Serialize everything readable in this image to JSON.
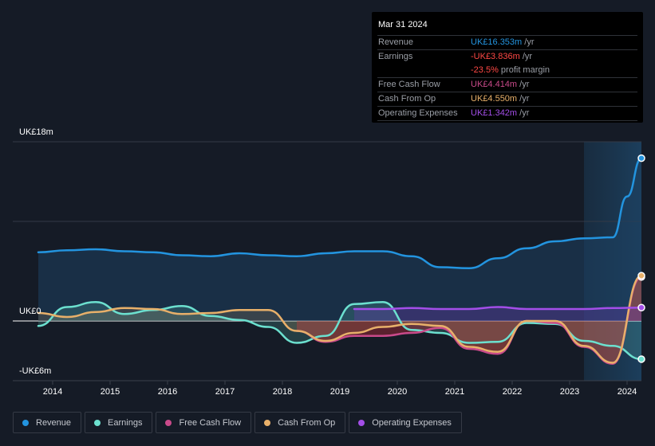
{
  "tooltip": {
    "date": "Mar 31 2024",
    "rows": [
      {
        "label": "Revenue",
        "value": "UK£16.353m",
        "unit": " /yr",
        "color": "#2394df"
      },
      {
        "label": "Earnings",
        "value": "-UK£3.836m",
        "unit": " /yr",
        "color": "#ff4845"
      },
      {
        "label": "",
        "value": "-23.5%",
        "unit": " profit margin",
        "color": "#ff4845"
      },
      {
        "label": "Free Cash Flow",
        "value": "UK£4.414m",
        "unit": " /yr",
        "color": "#c94a8a"
      },
      {
        "label": "Cash From Op",
        "value": "UK£4.550m",
        "unit": " /yr",
        "color": "#e8b06a"
      },
      {
        "label": "Operating Expenses",
        "value": "UK£1.342m",
        "unit": " /yr",
        "color": "#a34ee8"
      }
    ]
  },
  "legend": [
    {
      "label": "Revenue",
      "color": "#2394df"
    },
    {
      "label": "Earnings",
      "color": "#6ce0cf"
    },
    {
      "label": "Free Cash Flow",
      "color": "#c94a8a"
    },
    {
      "label": "Cash From Op",
      "color": "#e8b06a"
    },
    {
      "label": "Operating Expenses",
      "color": "#a34ee8"
    }
  ],
  "chart_data": {
    "type": "line",
    "title": "",
    "xlabel": "",
    "ylabel": "",
    "ylim": [
      -6,
      18
    ],
    "xlim": [
      2013.75,
      2024.25
    ],
    "y_tick_labels": [
      {
        "value": 18,
        "label": "UK£18m"
      },
      {
        "value": 0,
        "label": "UK£0"
      },
      {
        "value": -6,
        "label": "-UK£6m"
      }
    ],
    "gridlines": [
      18,
      10,
      0
    ],
    "x_ticks": [
      2014,
      2015,
      2016,
      2017,
      2018,
      2019,
      2020,
      2021,
      2022,
      2023,
      2024
    ],
    "x_tick_labels": [
      "2014",
      "2015",
      "2016",
      "2017",
      "2018",
      "2019",
      "2020",
      "2021",
      "2022",
      "2023",
      "2024"
    ],
    "highlight_from": 2023.25,
    "series": [
      {
        "name": "Revenue",
        "color": "#2394df",
        "fill": true,
        "points": [
          [
            2013.75,
            6.9
          ],
          [
            2014.25,
            7.1
          ],
          [
            2014.75,
            7.2
          ],
          [
            2015.25,
            7.0
          ],
          [
            2015.75,
            6.9
          ],
          [
            2016.25,
            6.6
          ],
          [
            2016.75,
            6.5
          ],
          [
            2017.25,
            6.8
          ],
          [
            2017.75,
            6.6
          ],
          [
            2018.25,
            6.5
          ],
          [
            2018.75,
            6.8
          ],
          [
            2019.25,
            7.0
          ],
          [
            2019.75,
            7.0
          ],
          [
            2020.25,
            6.5
          ],
          [
            2020.75,
            5.4
          ],
          [
            2021.25,
            5.3
          ],
          [
            2021.75,
            6.3
          ],
          [
            2022.25,
            7.3
          ],
          [
            2022.75,
            8.0
          ],
          [
            2023.25,
            8.3
          ],
          [
            2023.75,
            8.4
          ],
          [
            2024.0,
            12.5
          ],
          [
            2024.25,
            16.353
          ]
        ]
      },
      {
        "name": "Earnings",
        "color": "#6ce0cf",
        "fill": true,
        "points": [
          [
            2013.75,
            -0.5
          ],
          [
            2014.25,
            1.4
          ],
          [
            2014.75,
            1.9
          ],
          [
            2015.25,
            0.7
          ],
          [
            2015.75,
            1.1
          ],
          [
            2016.25,
            1.5
          ],
          [
            2016.75,
            0.5
          ],
          [
            2017.25,
            0.1
          ],
          [
            2017.75,
            -0.6
          ],
          [
            2018.25,
            -2.2
          ],
          [
            2018.75,
            -1.5
          ],
          [
            2019.25,
            1.7
          ],
          [
            2019.75,
            1.9
          ],
          [
            2020.25,
            -0.9
          ],
          [
            2020.75,
            -1.2
          ],
          [
            2021.25,
            -2.2
          ],
          [
            2021.75,
            -2.1
          ],
          [
            2022.25,
            -0.2
          ],
          [
            2022.75,
            -0.3
          ],
          [
            2023.25,
            -2.0
          ],
          [
            2023.75,
            -2.5
          ],
          [
            2024.25,
            -3.836
          ]
        ]
      },
      {
        "name": "Free Cash Flow",
        "color": "#c94a8a",
        "fill": true,
        "points": [
          [
            2018.25,
            -1.0
          ],
          [
            2018.75,
            -2.1
          ],
          [
            2019.25,
            -1.5
          ],
          [
            2019.75,
            -1.5
          ],
          [
            2020.25,
            -1.2
          ],
          [
            2020.75,
            -0.7
          ],
          [
            2021.25,
            -2.8
          ],
          [
            2021.75,
            -3.3
          ],
          [
            2022.25,
            0.0
          ],
          [
            2022.75,
            -0.2
          ],
          [
            2023.25,
            -2.6
          ],
          [
            2023.75,
            -4.3
          ],
          [
            2024.25,
            4.414
          ]
        ]
      },
      {
        "name": "Cash From Op",
        "color": "#e8b06a",
        "fill": true,
        "points": [
          [
            2013.75,
            0.8
          ],
          [
            2014.25,
            0.4
          ],
          [
            2014.75,
            0.9
          ],
          [
            2015.25,
            1.3
          ],
          [
            2015.75,
            1.2
          ],
          [
            2016.25,
            0.7
          ],
          [
            2016.75,
            0.8
          ],
          [
            2017.25,
            1.1
          ],
          [
            2017.75,
            1.1
          ],
          [
            2018.25,
            -1.0
          ],
          [
            2018.75,
            -2.0
          ],
          [
            2019.25,
            -1.2
          ],
          [
            2019.75,
            -0.6
          ],
          [
            2020.25,
            -0.3
          ],
          [
            2020.75,
            -0.5
          ],
          [
            2021.25,
            -2.6
          ],
          [
            2021.75,
            -3.1
          ],
          [
            2022.25,
            0.0
          ],
          [
            2022.75,
            0.0
          ],
          [
            2023.25,
            -2.5
          ],
          [
            2023.75,
            -4.2
          ],
          [
            2024.25,
            4.55
          ]
        ]
      },
      {
        "name": "Operating Expenses",
        "color": "#a34ee8",
        "fill": true,
        "points": [
          [
            2019.25,
            1.2
          ],
          [
            2019.75,
            1.2
          ],
          [
            2020.25,
            1.3
          ],
          [
            2020.75,
            1.2
          ],
          [
            2021.25,
            1.2
          ],
          [
            2021.75,
            1.4
          ],
          [
            2022.25,
            1.2
          ],
          [
            2022.75,
            1.2
          ],
          [
            2023.25,
            1.2
          ],
          [
            2023.75,
            1.3
          ],
          [
            2024.25,
            1.342
          ]
        ]
      }
    ]
  }
}
